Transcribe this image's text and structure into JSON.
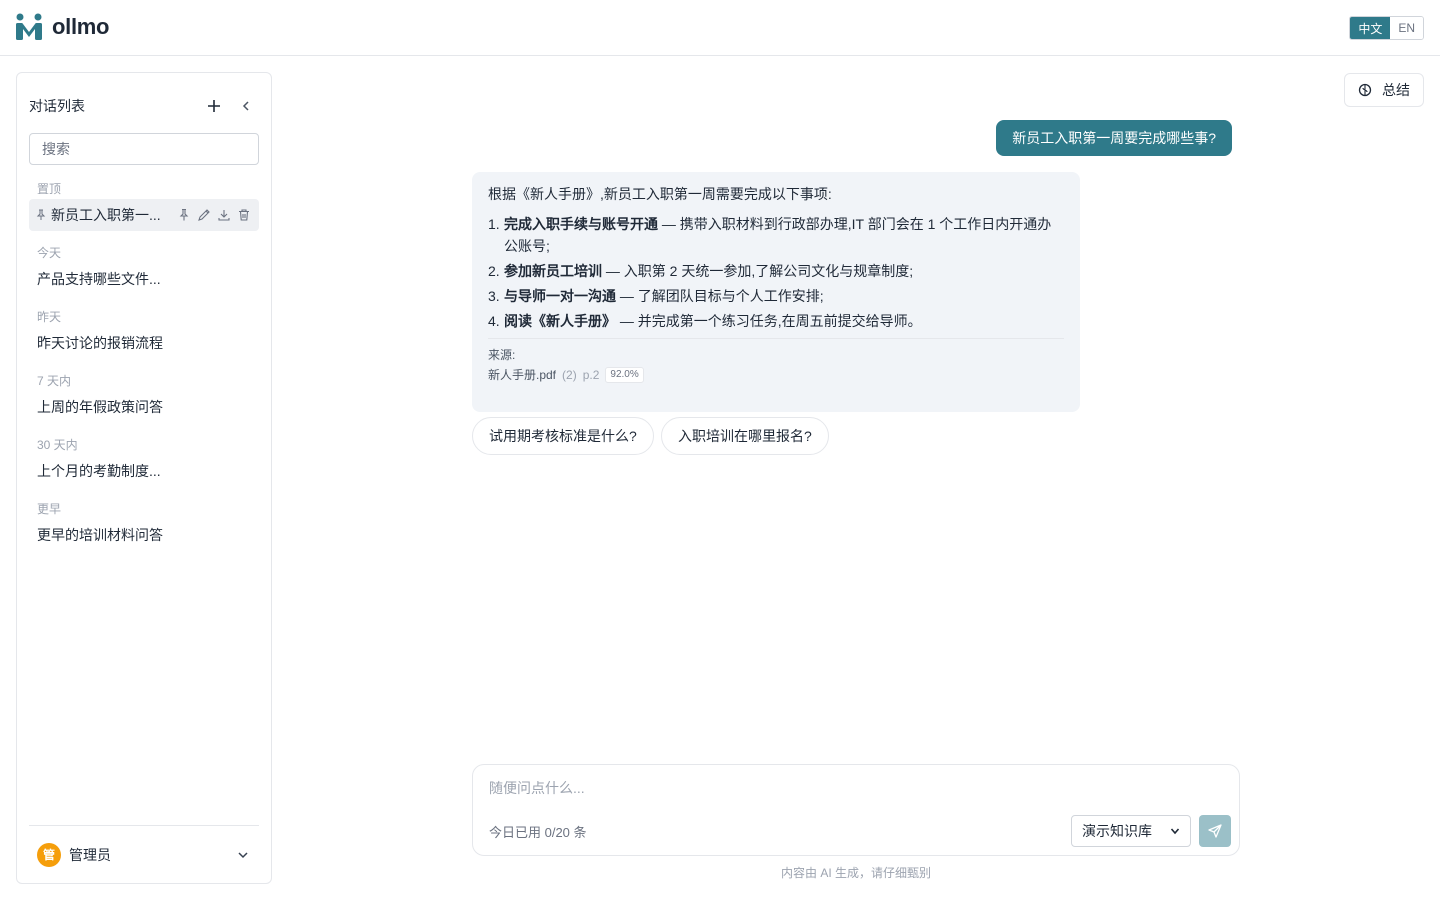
{
  "app": {
    "name": "ollmo"
  },
  "lang": {
    "zh": "中文",
    "en": "EN"
  },
  "sidebar": {
    "title": "对话列表",
    "search_placeholder": "搜索",
    "groups": [
      {
        "label": "置顶",
        "items": [
          "新员工入职第一..."
        ]
      },
      {
        "label": "今天",
        "items": [
          "产品支持哪些文件..."
        ]
      },
      {
        "label": "昨天",
        "items": [
          "昨天讨论的报销流程"
        ]
      },
      {
        "label": "7 天内",
        "items": [
          "上周的年假政策问答"
        ]
      },
      {
        "label": "30 天内",
        "items": [
          "上个月的考勤制度..."
        ]
      },
      {
        "label": "更早",
        "items": [
          "更早的培训材料问答"
        ]
      }
    ],
    "user": {
      "avatar_text": "管",
      "name": "管理员"
    }
  },
  "header": {
    "summary_label": "总结"
  },
  "chat": {
    "user_message": "新员工入职第一周要完成哪些事?",
    "assistant": {
      "intro": "根据《新人手册》,新员工入职第一周需要完成以下事项:",
      "items": [
        {
          "num": "1.",
          "title": "完成入职手续与账号开通",
          "desc": " — 携带入职材料到行政部办理,IT 部门会在 1 个工作日内开通办公账号;"
        },
        {
          "num": "2.",
          "title": "参加新员工培训",
          "desc": " — 入职第 2 天统一参加,了解公司文化与规章制度;"
        },
        {
          "num": "3.",
          "title": "与导师一对一沟通",
          "desc": " — 了解团队目标与个人工作安排;"
        },
        {
          "num": "4.",
          "title": "阅读《新人手册》",
          "desc": " — 并完成第一个练习任务,在周五前提交给导师。"
        }
      ],
      "source_label": "来源:",
      "source": {
        "file": "新人手册.pdf",
        "count": "(2)",
        "page": "p.2",
        "score": "92.0%"
      }
    },
    "suggestions": [
      "试用期考核标准是什么?",
      "入职培训在哪里报名?"
    ]
  },
  "composer": {
    "placeholder": "随便问点什么...",
    "usage": "今日已用 0/20 条",
    "knowledge_base": "演示知识库"
  },
  "disclaimer": "内容由 AI 生成，请仔细甄别",
  "colors": {
    "accent": "#2f7a8a",
    "send_disabled": "#9bc0c8",
    "avatar": "#f59e0b"
  }
}
